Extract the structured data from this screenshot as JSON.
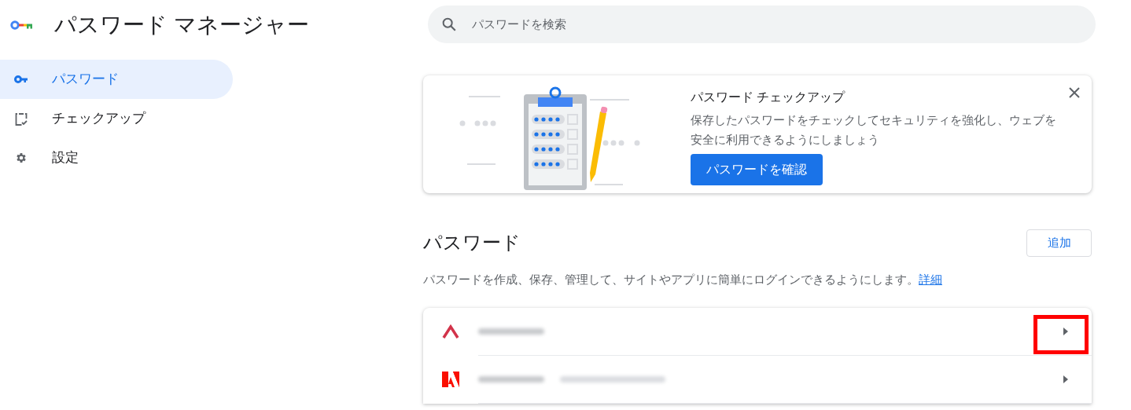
{
  "app_title": "パスワード マネージャー",
  "nav": [
    {
      "kind": "key",
      "label": "パスワード",
      "selected": true
    },
    {
      "kind": "checkup",
      "label": "チェックアップ",
      "selected": false
    },
    {
      "kind": "settings",
      "label": "設定",
      "selected": false
    }
  ],
  "search": {
    "placeholder": "パスワードを検索"
  },
  "checkup_card": {
    "title": "パスワード チェックアップ",
    "body": "保存したパスワードをチェックしてセキュリティを強化し、ウェブを安全に利用できるようにしましょう",
    "button": "パスワードを確認"
  },
  "passwords": {
    "title": "パスワード",
    "add_button": "追加",
    "description": "パスワードを作成、保存、管理して、サイトやアプリに簡単にログインできるようにします。",
    "link": "詳細",
    "rows": [
      {
        "kind": "caret",
        "account_note": false,
        "highlighted": true
      },
      {
        "kind": "adobe",
        "account_note": true,
        "highlighted": false
      }
    ]
  }
}
